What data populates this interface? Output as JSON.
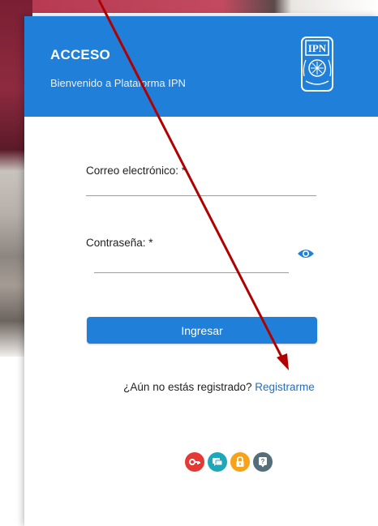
{
  "dialog": {
    "title": "ACCESO",
    "subtitle": "Bienvenido a Plataforma IPN",
    "logo_text": "IPN"
  },
  "form": {
    "email_label": "Correo electrónico: *",
    "email_value": "",
    "password_label": "Contraseña: *",
    "password_value": "",
    "submit_label": "Ingresar"
  },
  "register": {
    "prompt": "¿Aún no estás registrado?",
    "link_label": "Registrarme"
  },
  "quick_icons": [
    {
      "name": "key-icon",
      "color": "#e53935"
    },
    {
      "name": "chat-icon",
      "color": "#1ea7b8"
    },
    {
      "name": "lock-icon",
      "color": "#f6a21a"
    },
    {
      "name": "help-icon",
      "color": "#546e7a"
    }
  ],
  "colors": {
    "header": "#1f7fd9",
    "button": "#1f7fd9",
    "link": "#1f6fc5",
    "annotation_arrow": "#b00000"
  }
}
